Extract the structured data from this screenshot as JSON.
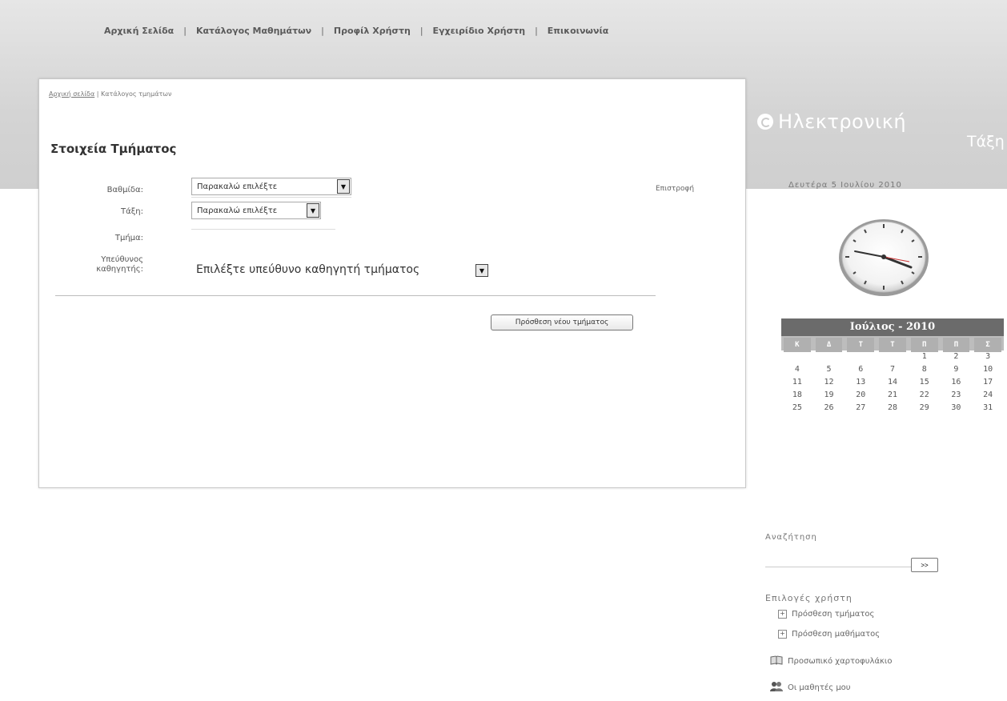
{
  "nav": {
    "items": [
      "Αρχική Σελίδα",
      "Κατάλογος Μαθημάτων",
      "Προφίλ Χρήστη",
      "Εγχειρίδιο Χρήστη",
      "Επικοινωνία"
    ],
    "separator": "|"
  },
  "breadcrumb": {
    "home": "Αρχική σελίδα",
    "sep": "|",
    "current": "Κατάλογος τμημάτων"
  },
  "form": {
    "title": "Στοιχεία Τμήματος",
    "grade_label": "Βαθμίδα:",
    "grade_value": "Παρακαλώ επιλέξτε",
    "class_label": "Τάξη:",
    "class_value": "Παρακαλώ επιλέξτε",
    "section_label": "Τμήμα:",
    "teacher_label_1": "Υπεύθυνος",
    "teacher_label_2": "καθηγητής:",
    "teacher_value": "Επιλέξτε υπεύθυνο καθηγητή τμήματος",
    "back_link": "Επιστροφή",
    "add_button": "Πρόσθεση νέου τμήματος"
  },
  "logo": {
    "line1": "Ηλεκτρονική",
    "line2": "Τάξη"
  },
  "date_text": "Δευτέρα 5 Ιουλίου 2010",
  "calendar": {
    "header": "Ιούλιος - 2010",
    "weekdays": [
      "Κ",
      "Δ",
      "Τ",
      "Τ",
      "Π",
      "Π",
      "Σ"
    ],
    "weeks": [
      [
        "",
        "",
        "",
        "",
        "1",
        "2",
        "3"
      ],
      [
        "4",
        "5",
        "6",
        "7",
        "8",
        "9",
        "10"
      ],
      [
        "11",
        "12",
        "13",
        "14",
        "15",
        "16",
        "17"
      ],
      [
        "18",
        "19",
        "20",
        "21",
        "22",
        "23",
        "24"
      ],
      [
        "25",
        "26",
        "27",
        "28",
        "29",
        "30",
        "31"
      ]
    ]
  },
  "search": {
    "label": "Αναζήτηση",
    "button": ">>"
  },
  "options": {
    "title": "Επιλογές χρήστη",
    "add_section": "Πρόσθεση τμήματος",
    "add_course": "Πρόσθεση μαθήματος",
    "portfolio": "Προσωπικό χαρτοφυλάκιο",
    "my_students": "Οι μαθητές μου"
  }
}
